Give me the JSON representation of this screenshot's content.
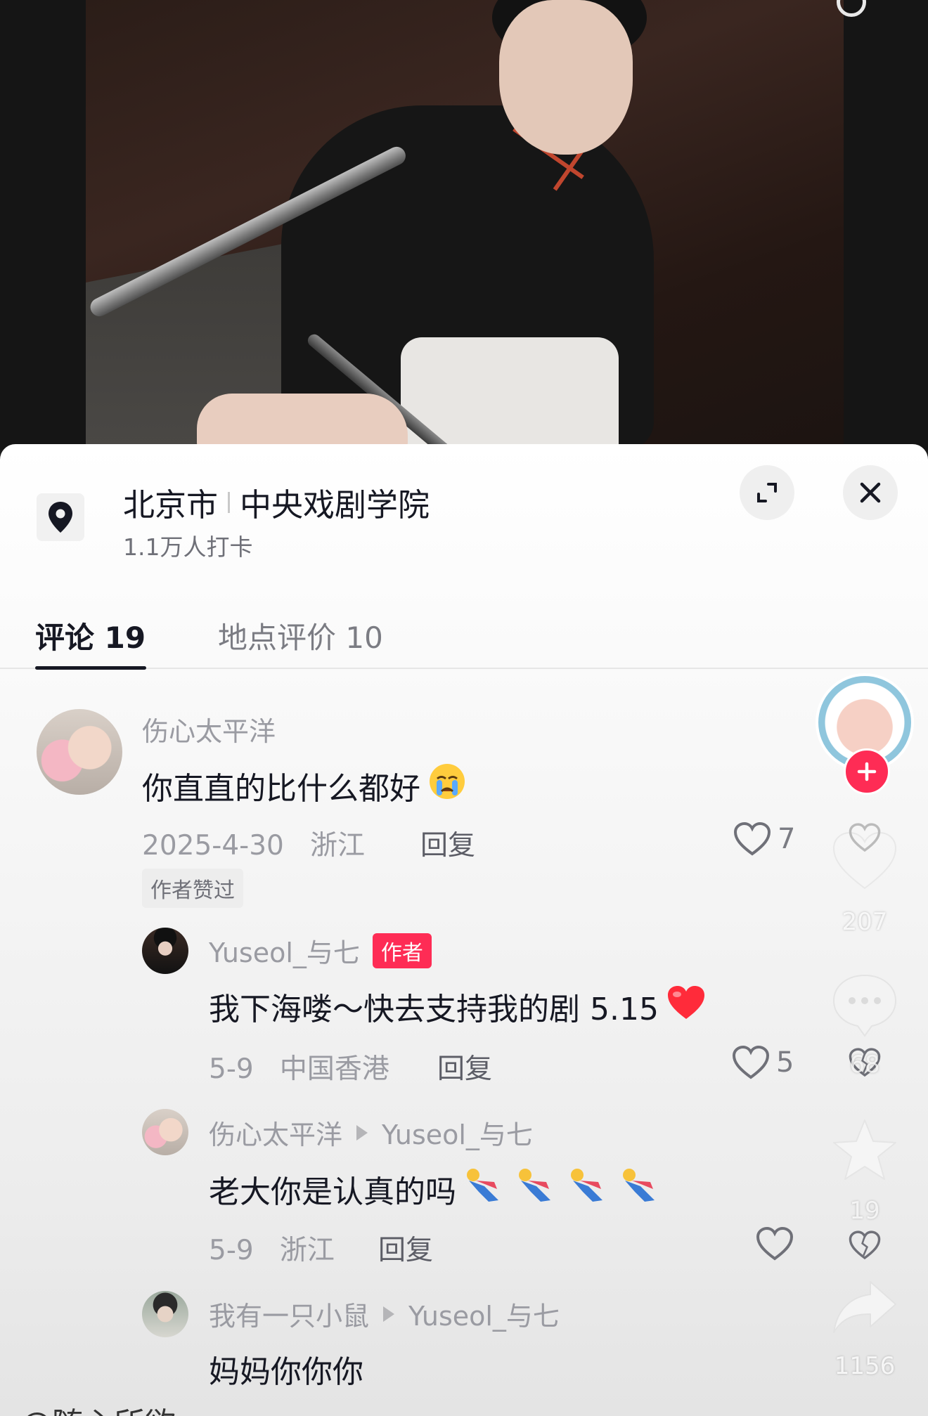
{
  "location": {
    "city": "北京市",
    "place": "中央戏剧学院",
    "checkins": "1.1万人打卡"
  },
  "tabs": [
    {
      "label": "评论 19",
      "active": true
    },
    {
      "label": "地点评价 10",
      "active": false
    }
  ],
  "comments": [
    {
      "user": "伤心太平洋",
      "text": "你直直的比什么都好",
      "date": "2025-4-30",
      "region": "浙江",
      "reply_label": "回复",
      "likes": "7",
      "badge": "作者赞过"
    },
    {
      "user": "Yuseol_与七",
      "author_badge": "作者",
      "text": "我下海喽～快去支持我的剧 5.15",
      "date": "5-9",
      "region": "中国香港",
      "reply_label": "回复",
      "likes": "5"
    },
    {
      "user": "伤心太平洋",
      "reply_to": "Yuseol_与七",
      "text": "老大你是认真的吗",
      "date": "5-9",
      "region": "浙江",
      "reply_label": "回复",
      "likes": ""
    },
    {
      "user": "我有一只小鼠",
      "reply_to": "Yuseol_与七",
      "text": "妈妈你你你"
    }
  ],
  "actions": {
    "likes": "207",
    "comments": "68",
    "favorites": "19",
    "shares": "1156"
  },
  "caption": "@随心所欲",
  "colors": {
    "accent": "#fe2c55",
    "text_primary": "#161823",
    "text_secondary": "#9a9ba2"
  }
}
